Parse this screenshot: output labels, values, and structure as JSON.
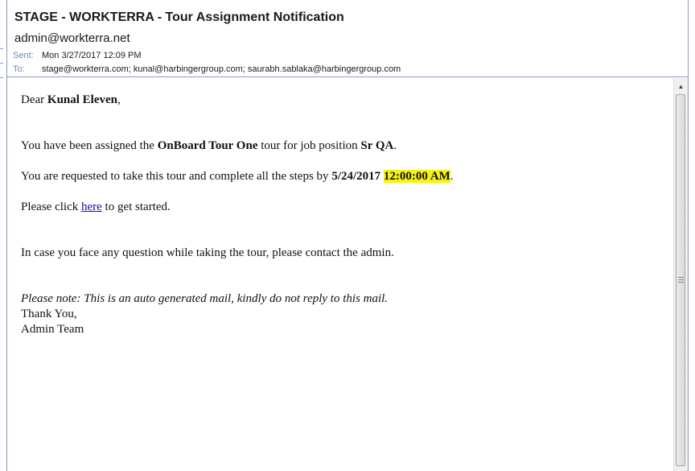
{
  "header": {
    "subject": "STAGE - WORKTERRA - Tour Assignment Notification",
    "from": "admin@workterra.net",
    "sent_label": "Sent:",
    "sent_value": "Mon 3/27/2017 12:09 PM",
    "to_label": "To:",
    "to_value": "stage@workterra.com; kunal@harbingergroup.com; saurabh.sablaka@harbingergroup.com"
  },
  "message": {
    "greeting_prefix": "Dear ",
    "recipient_name": "Kunal Eleven",
    "greeting_suffix": ",",
    "assign_prefix": "You have been assigned the ",
    "tour_name": "OnBoard Tour One",
    "assign_mid": " tour for job position ",
    "job_position": "Sr QA",
    "assign_suffix": ".",
    "request_prefix": "You are requested to take this tour and complete all the steps by ",
    "due_date": "5/24/2017",
    "due_time": "12:00:00 AM",
    "request_suffix": ".",
    "click_prefix": "Please click ",
    "link_text": "here",
    "click_suffix": " to get started.",
    "question_text": "In case you face any question while taking the tour, please contact the admin.",
    "note_text": "Please note: This is an auto generated mail, kindly do not reply to this mail.",
    "thanks_text": "Thank You,",
    "signature": "Admin Team"
  },
  "colors": {
    "highlight": "#f4f410",
    "link": "#1a0dab",
    "label_blue": "#6a8bb6"
  },
  "icons": {
    "scroll_up": "triangle-up-icon"
  }
}
